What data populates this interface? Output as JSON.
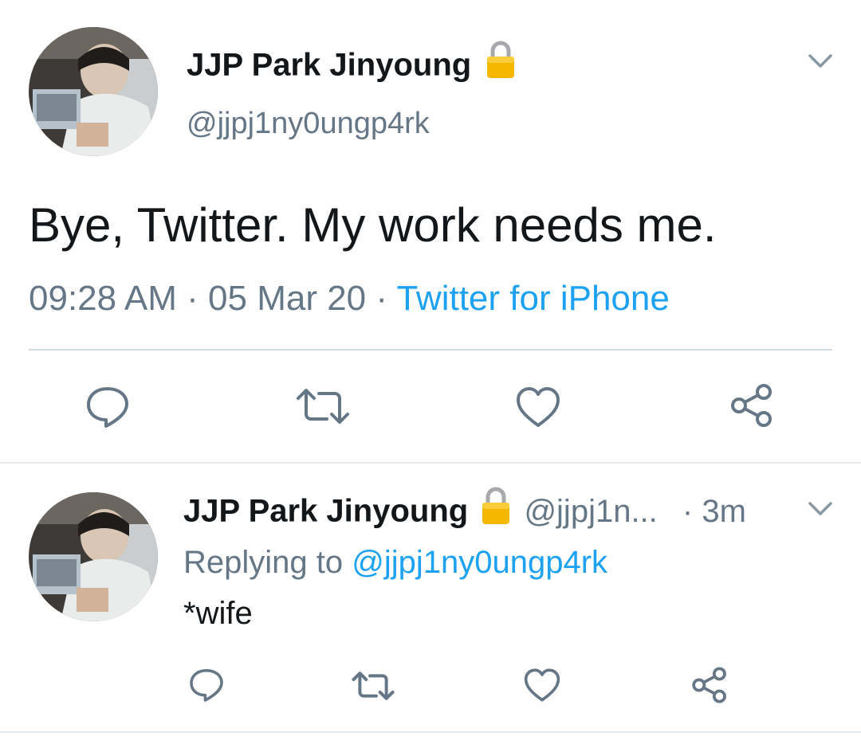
{
  "main_tweet": {
    "author_name": "JJP Park Jinyoung",
    "handle": "@jjpj1ny0ungp4rk",
    "text": "Bye, Twitter. My work needs me.",
    "time": "09:28 AM",
    "date": "05 Mar 20",
    "source": "Twitter for iPhone",
    "separator": "·"
  },
  "reply_tweet": {
    "author_name": "JJP Park Jinyoung",
    "handle_truncated": "@jjpj1n...",
    "age": "· 3m",
    "replying_label": "Replying to",
    "replying_handle": "@jjpj1ny0ungp4rk",
    "text": "*wife"
  },
  "icons": {
    "reply": "reply-icon",
    "retweet": "retweet-icon",
    "like": "heart-icon",
    "share": "share-icon",
    "lock": "lock-icon",
    "caret": "chevron-down-icon"
  },
  "colors": {
    "text": "#14171a",
    "secondary": "#657786",
    "link": "#1da1f2",
    "divider": "#e6ecf0",
    "icon": "#657786",
    "lock": "#f5b800"
  }
}
